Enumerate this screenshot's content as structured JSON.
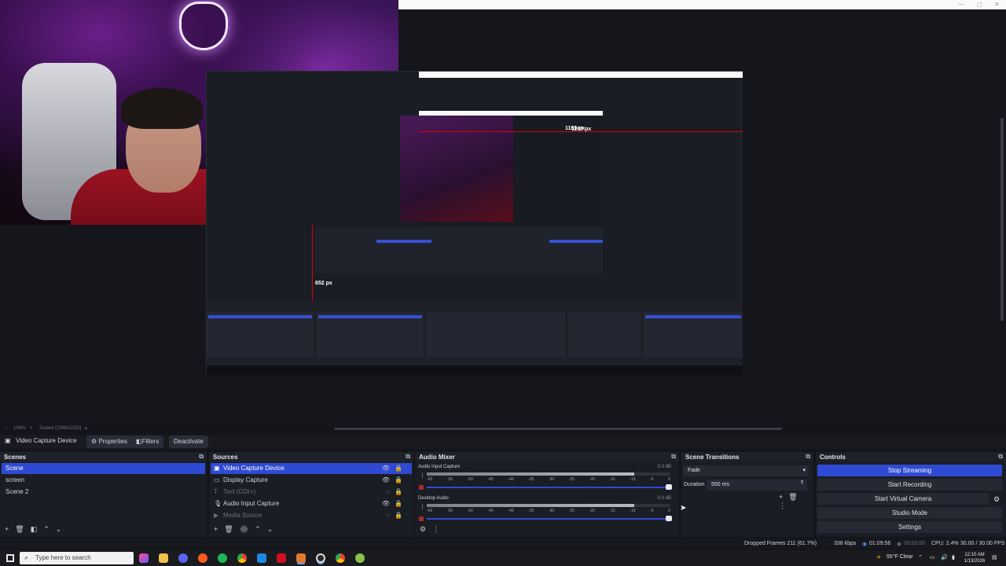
{
  "preview": {
    "px_width_label": "1160 px",
    "px_height_label": "652 px",
    "inner_px_label": "1160 px",
    "window_controls": [
      "—",
      "◻",
      "✕"
    ]
  },
  "statusline": {
    "zoom": "106%",
    "scaled": "Scaled (2048x1152)"
  },
  "source_toolbar": {
    "source_name": "Video Capture Device",
    "properties_label": "Properties",
    "filters_label": "Filters",
    "deactivate_label": "Deactivate"
  },
  "scenes": {
    "title": "Scenes",
    "items": [
      "Scene",
      "screen",
      "Scene 2"
    ]
  },
  "sources": {
    "title": "Sources",
    "items": [
      {
        "label": "Video Capture Device",
        "icon": "camera-icon"
      },
      {
        "label": "Display Capture",
        "icon": "monitor-icon"
      },
      {
        "label": "Text (GDI+)",
        "icon": "text-icon"
      },
      {
        "label": "Audio Input Capture",
        "icon": "microphone-icon"
      },
      {
        "label": "Media Source",
        "icon": "play-icon"
      }
    ]
  },
  "mixer": {
    "title": "Audio Mixer",
    "channels": [
      {
        "name": "Audio Input Capture",
        "db": "0.0 dB",
        "level": 0.85
      },
      {
        "name": "Desktop Audio",
        "db": "0.0 dB",
        "level": 0.85
      }
    ],
    "ticks": [
      "-60",
      "-55",
      "-50",
      "-45",
      "-40",
      "-35",
      "-30",
      "-25",
      "-20",
      "-15",
      "-10",
      "-5",
      "0"
    ]
  },
  "transitions": {
    "title": "Scene Transitions",
    "selected": "Fade",
    "duration_label": "Duration",
    "duration_value": "550 ms"
  },
  "controls": {
    "title": "Controls",
    "stop_streaming": "Stop Streaming",
    "start_recording": "Start Recording",
    "start_virtual_camera": "Start Virtual Camera",
    "studio_mode": "Studio Mode",
    "settings": "Settings"
  },
  "status": {
    "dropped_frames": "Dropped Frames 211 (61.7%)",
    "kbps": "338 kbps",
    "stream_time": "01:09:56",
    "record_time": "00:00:00",
    "cpu": "CPU: 2.4%",
    "fps": "30.00 / 30.00 FPS"
  },
  "taskbar": {
    "search_placeholder": "Type here to search",
    "weather": "55°F  Clear",
    "time": "12:10 AM",
    "date": "1/13/2026"
  }
}
